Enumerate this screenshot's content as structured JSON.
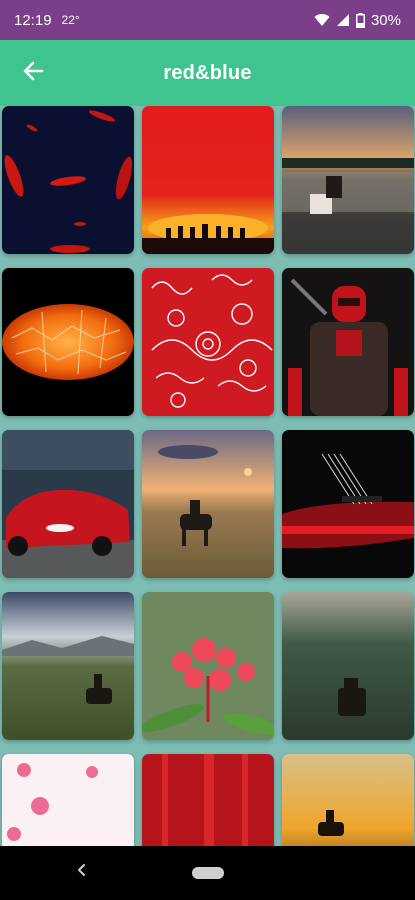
{
  "status": {
    "time": "12:19",
    "temp": "22°",
    "battery": "30%"
  },
  "app_bar": {
    "title": "red&blue"
  },
  "tiles": [
    {
      "icon": "red-feathers-wallpaper"
    },
    {
      "icon": "red-sunset-riders-wallpaper"
    },
    {
      "icon": "rider-at-lake-wallpaper"
    },
    {
      "icon": "glowing-orange-orb-wallpaper"
    },
    {
      "icon": "red-bandana-pattern-wallpaper"
    },
    {
      "icon": "red-hood-soldier-wallpaper"
    },
    {
      "icon": "red-sports-car-wallpaper"
    },
    {
      "icon": "rider-on-plains-wallpaper"
    },
    {
      "icon": "red-guitar-wallpaper"
    },
    {
      "icon": "rider-on-hills-wallpaper"
    },
    {
      "icon": "red-flower-wallpaper"
    },
    {
      "icon": "rider-in-forest-wallpaper"
    },
    {
      "icon": "pink-blossoms-wallpaper"
    },
    {
      "icon": "red-stripes-wallpaper"
    },
    {
      "icon": "golden-sunset-rider-wallpaper"
    }
  ],
  "colors": {
    "status_bar": "#7b3f8a",
    "app_bar": "#3fc490",
    "background": "#7dbdb3",
    "nav_bar": "#000000"
  }
}
